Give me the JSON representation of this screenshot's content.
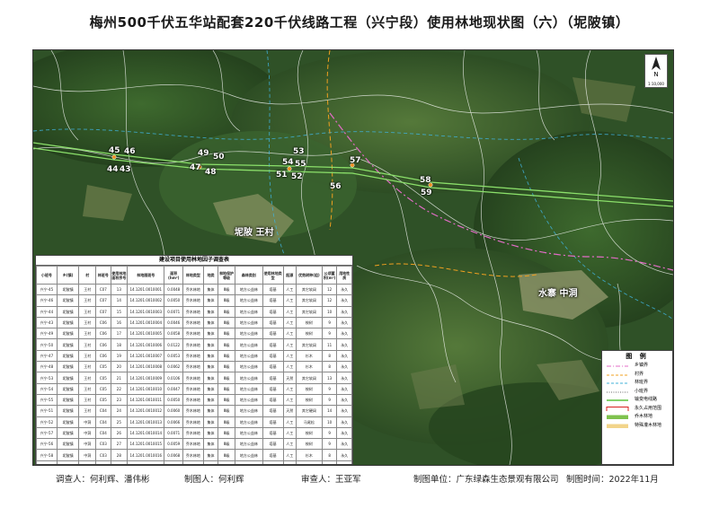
{
  "title": "梅州500千伏五华站配套220千伏线路工程（兴宁段）使用林地现状图（六）（坭陂镇）",
  "compass": {
    "north": "N",
    "scale": "1:10,000"
  },
  "parcels": [
    "45",
    "46",
    "44",
    "43",
    "49",
    "50",
    "47",
    "48",
    "53",
    "54",
    "55",
    "51",
    "52",
    "57",
    "56",
    "58",
    "59"
  ],
  "villages": [
    "坭陂 王村",
    "水寨 中洞"
  ],
  "table": {
    "title": "建设项目使用林地因子调查表",
    "headers": [
      "小班号",
      "乡(镇)",
      "村",
      "林班号",
      "使用林地面积序号",
      "林地图斑号",
      "面积(hm²)",
      "林地类型",
      "地类",
      "林地保护等级",
      "森林类别",
      "使用林地类型",
      "起源",
      "优势树种(组)",
      "公顷蓄积(m³)",
      "用地性质"
    ],
    "rows": [
      [
        "兴宁-45",
        "坭陂镇",
        "王村",
        "C07",
        "13",
        "14.1201.0010001",
        "0.0048",
        "乔木林地",
        "集体",
        "Ⅲ级",
        "地方公益林",
        "塔基",
        "人工",
        "其它软阔",
        "12",
        "永久"
      ],
      [
        "兴宁-46",
        "坭陂镇",
        "王村",
        "C07",
        "14",
        "14.1201.0010002",
        "0.0050",
        "乔木林地",
        "集体",
        "Ⅲ级",
        "地方公益林",
        "塔基",
        "人工",
        "其它软阔",
        "12",
        "永久"
      ],
      [
        "兴宁-44",
        "坭陂镇",
        "王村",
        "C07",
        "15",
        "14.1201.0010003",
        "0.0071",
        "乔木林地",
        "集体",
        "Ⅲ级",
        "地方公益林",
        "塔基",
        "人工",
        "其它软阔",
        "10",
        "永久"
      ],
      [
        "兴宁-43",
        "坭陂镇",
        "王村",
        "C06",
        "16",
        "14.1201.0010004",
        "0.0046",
        "乔木林地",
        "集体",
        "Ⅲ级",
        "地方公益林",
        "塔基",
        "人工",
        "桉树",
        "9",
        "永久"
      ],
      [
        "兴宁-49",
        "坭陂镇",
        "王村",
        "C06",
        "17",
        "14.1201.0010005",
        "0.0058",
        "乔木林地",
        "集体",
        "Ⅲ级",
        "地方公益林",
        "塔基",
        "人工",
        "桉树",
        "9",
        "永久"
      ],
      [
        "兴宁-50",
        "坭陂镇",
        "王村",
        "C06",
        "18",
        "14.1201.0010006",
        "0.0122",
        "乔木林地",
        "集体",
        "Ⅲ级",
        "地方公益林",
        "塔基",
        "人工",
        "其它软阔",
        "11",
        "永久"
      ],
      [
        "兴宁-47",
        "坭陂镇",
        "王村",
        "C06",
        "19",
        "14.1201.0010007",
        "0.0053",
        "乔木林地",
        "集体",
        "Ⅲ级",
        "地方公益林",
        "塔基",
        "人工",
        "杉木",
        "8",
        "永久"
      ],
      [
        "兴宁-48",
        "坭陂镇",
        "王村",
        "C05",
        "20",
        "14.1201.0010008",
        "0.0062",
        "乔木林地",
        "集体",
        "Ⅲ级",
        "地方公益林",
        "塔基",
        "人工",
        "杉木",
        "8",
        "永久"
      ],
      [
        "兴宁-53",
        "坭陂镇",
        "王村",
        "C05",
        "21",
        "14.1201.0010009",
        "0.0106",
        "乔木林地",
        "集体",
        "Ⅲ级",
        "地方公益林",
        "塔基",
        "天然",
        "其它软阔",
        "13",
        "永久"
      ],
      [
        "兴宁-54",
        "坭陂镇",
        "王村",
        "C05",
        "22",
        "14.1201.0010010",
        "0.0047",
        "乔木林地",
        "集体",
        "Ⅲ级",
        "地方公益林",
        "塔基",
        "人工",
        "桉树",
        "9",
        "永久"
      ],
      [
        "兴宁-55",
        "坭陂镇",
        "王村",
        "C05",
        "23",
        "14.1201.0010011",
        "0.0050",
        "乔木林地",
        "集体",
        "Ⅲ级",
        "地方公益林",
        "塔基",
        "人工",
        "桉树",
        "9",
        "永久"
      ],
      [
        "兴宁-51",
        "坭陂镇",
        "王村",
        "C04",
        "24",
        "14.1201.0010012",
        "0.0060",
        "乔木林地",
        "集体",
        "Ⅲ级",
        "地方公益林",
        "塔基",
        "天然",
        "其它硬阔",
        "14",
        "永久"
      ],
      [
        "兴宁-52",
        "坭陂镇",
        "中洞",
        "C04",
        "25",
        "14.1201.0010013",
        "0.0066",
        "乔木林地",
        "集体",
        "Ⅲ级",
        "地方公益林",
        "塔基",
        "人工",
        "马尾松",
        "10",
        "永久"
      ],
      [
        "兴宁-57",
        "坭陂镇",
        "中洞",
        "C04",
        "26",
        "14.1201.0010014",
        "0.0071",
        "乔木林地",
        "集体",
        "Ⅲ级",
        "地方公益林",
        "塔基",
        "人工",
        "桉树",
        "9",
        "永久"
      ],
      [
        "兴宁-56",
        "坭陂镇",
        "中洞",
        "C03",
        "27",
        "14.1201.0010015",
        "0.0059",
        "乔木林地",
        "集体",
        "Ⅲ级",
        "地方公益林",
        "塔基",
        "人工",
        "桉树",
        "9",
        "永久"
      ],
      [
        "兴宁-58",
        "坭陂镇",
        "中洞",
        "C03",
        "28",
        "14.1201.0010016",
        "0.0068",
        "乔木林地",
        "集体",
        "Ⅲ级",
        "地方公益林",
        "塔基",
        "人工",
        "杉木",
        "8",
        "永久"
      ],
      [
        "兴宁-59",
        "坭陂镇",
        "中洞",
        "C03",
        "29",
        "14.1201.0010017",
        "0.0066",
        "乔木林地",
        "集体",
        "Ⅲ级",
        "地方公益林",
        "塔基",
        "人工",
        "杉木",
        "8",
        "永久"
      ]
    ]
  },
  "legend": {
    "title": "图 例",
    "items": [
      {
        "label": "乡镇界",
        "color": "#e36cc7",
        "style": "dashdot"
      },
      {
        "label": "村界",
        "color": "#f0a020",
        "style": "dash"
      },
      {
        "label": "林班界",
        "color": "#40b0d8",
        "style": "dash"
      },
      {
        "label": "小班界",
        "color": "#666666",
        "style": "dot"
      },
      {
        "label": "输变电线路",
        "color": "#5cc43c",
        "style": "solid"
      },
      {
        "label": "永久占用范围",
        "color": "#d81e1e",
        "style": "box"
      },
      {
        "label": "乔木林地",
        "color": "#7fc24e",
        "style": "fill"
      },
      {
        "label": "特殊灌木林地",
        "color": "#f2d48a",
        "style": "fill"
      }
    ]
  },
  "footer": {
    "surveyor": "调查人：何利辉、潘伟彬",
    "mapper": "制图人：何利辉",
    "reviewer": "审查人：王亚军",
    "unit": "制图单位：广东绿森生态景观有限公司",
    "date": "制图时间：2022年11月"
  }
}
